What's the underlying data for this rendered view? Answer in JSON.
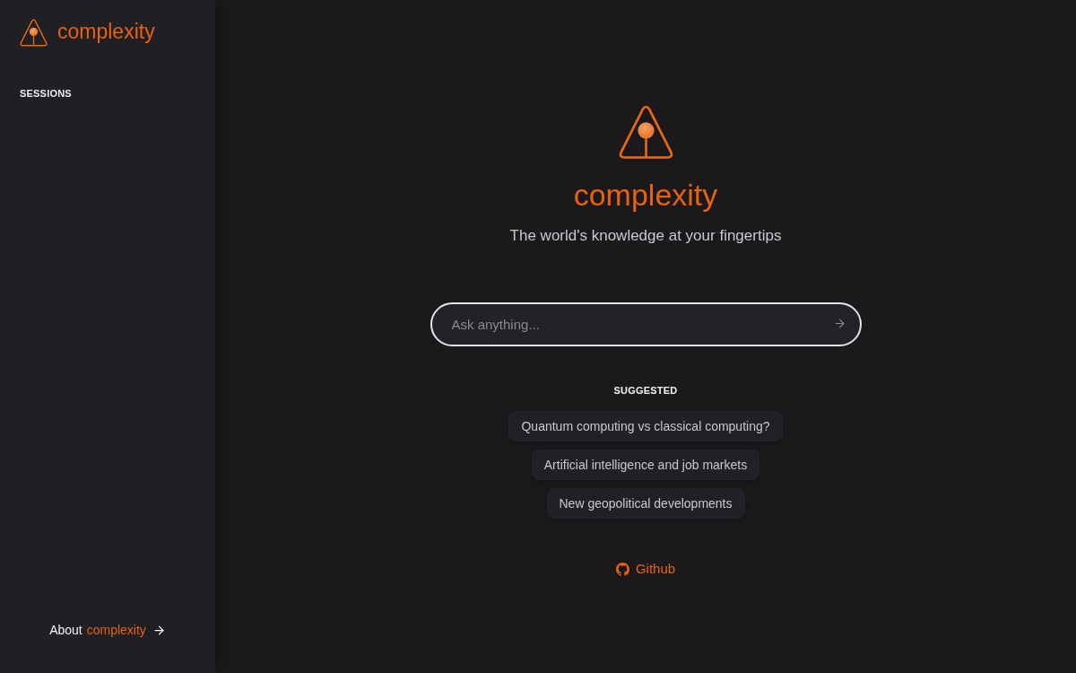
{
  "sidebar": {
    "brand": "complexity",
    "section_title": "SESSIONS",
    "about_link": {
      "prefix": "About",
      "highlight": "complexity"
    }
  },
  "hero": {
    "brand": "complexity",
    "tagline": "The world's knowledge at your fingertips"
  },
  "search": {
    "placeholder": "Ask anything..."
  },
  "suggested": {
    "title": "SUGGESTED",
    "items": [
      "Quantum computing vs classical computing?",
      "Artificial intelligence and job markets",
      "New geopolitical developments"
    ]
  },
  "github_link": {
    "label": "Github"
  }
}
